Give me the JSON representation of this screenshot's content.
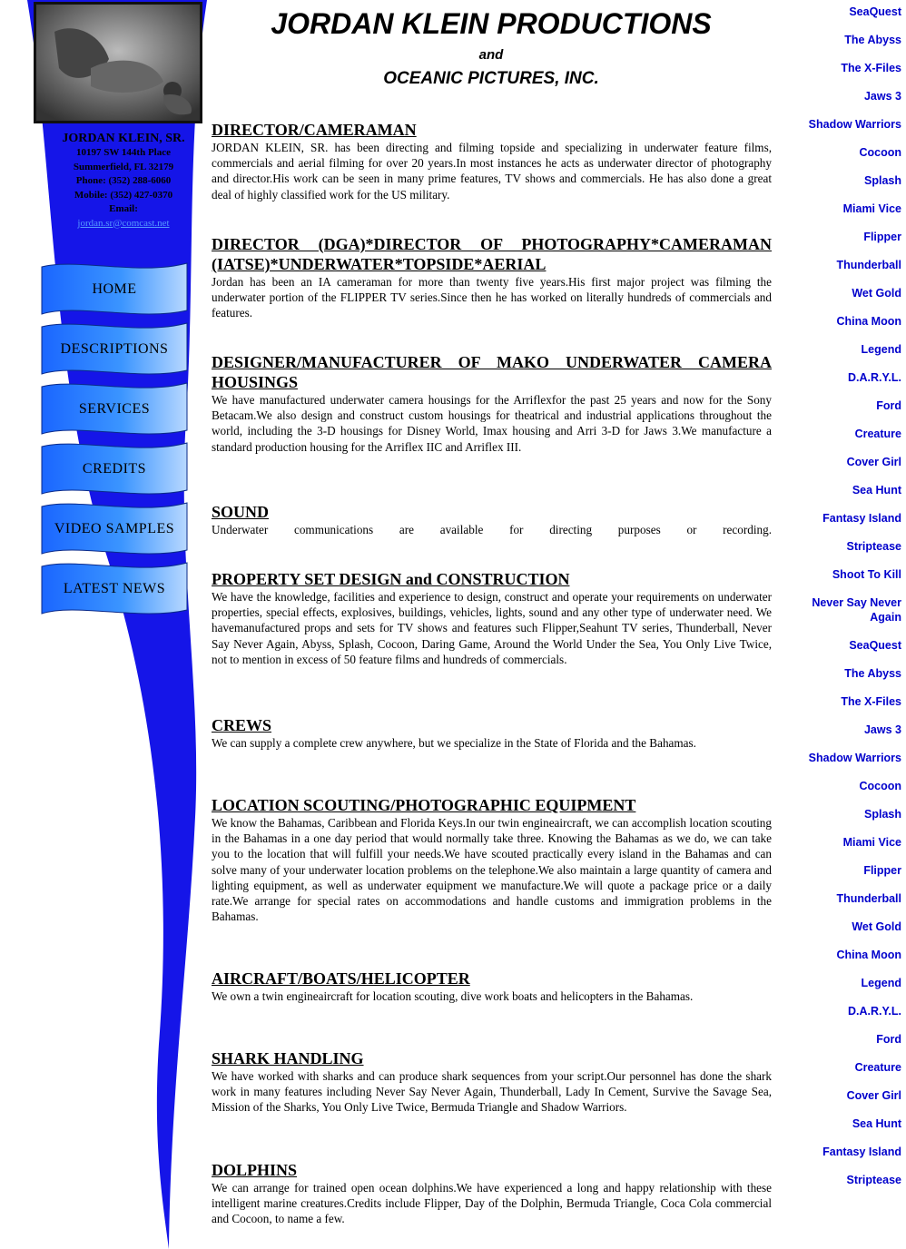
{
  "header": {
    "title": "JORDAN KLEIN PRODUCTIONS",
    "and": "and",
    "subtitle": "OCEANIC PICTURES, INC."
  },
  "contact": {
    "name": "JORDAN KLEIN, SR.",
    "address": "10197 SW 144th Place",
    "city": "Summerfield, FL  32179",
    "phone": "Phone:  (352) 288-6060",
    "mobile": "Mobile: (352) 427-0370",
    "email_label": "Email:",
    "email": "jordan.sr@comcast.net"
  },
  "nav": [
    {
      "label": "HOME"
    },
    {
      "label": "DESCRIPTIONS"
    },
    {
      "label": "SERVICES"
    },
    {
      "label": "CREDITS"
    },
    {
      "label": "VIDEO SAMPLES"
    },
    {
      "label": "LATEST NEWS"
    }
  ],
  "sections": [
    {
      "title": "DIRECTOR/CAMERAMAN",
      "body": "JORDAN KLEIN, SR. has been directing and filming topside and specializing in underwater feature films, commercials and aerial filming for over 20 years.In most instances he acts as underwater director of photography and director.His work can be seen in many prime features, TV shows and commercials. He has also done a great deal of highly classified work for the US military."
    },
    {
      "title": "DIRECTOR (DGA)*DIRECTOR OF PHOTOGRAPHY*CAMERAMAN (IATSE)*UNDERWATER*TOPSIDE*AERIAL",
      "body": "Jordan has been an IA cameraman for more than twenty five years.His first major project was filming the underwater portion of the FLIPPER TV series.Since then he has worked on literally hundreds of commercials and features."
    },
    {
      "title": "DESIGNER/MANUFACTURER OF MAKO UNDERWATER CAMERA HOUSINGS",
      "body": "We have manufactured underwater camera housings for the Arriflexfor the past 25 years and now for the Sony Betacam.We also design and construct custom housings for theatrical and industrial applications throughout the world, including the 3-D housings for Disney World, Imax housing and Arri 3-D for Jaws 3.We manufacture a standard production housing for the Arriflex IIC and Arriflex III."
    },
    {
      "title": "SOUND",
      "body": "Underwater communications are available for directing purposes or recording."
    },
    {
      "title": "PROPERTY SET DESIGN and CONSTRUCTION",
      "body": "We have the knowledge, facilities and experience to design, construct and operate your requirements on underwater properties, special effects, explosives, buildings, vehicles, lights, sound and any other type of underwater need. We havemanufactured props and sets for TV shows and features such Flipper,Seahunt TV series, Thunderball, Never Say Never Again, Abyss, Splash, Cocoon, Daring Game, Around the World Under the Sea, You Only Live Twice, not to mention in excess of 50 feature films and hundreds of commercials."
    },
    {
      "title": "CREWS",
      "body": "We can supply a complete crew anywhere, but we specialize in the State of Florida and the Bahamas."
    },
    {
      "title": "LOCATION SCOUTING/PHOTOGRAPHIC EQUIPMENT",
      "body": "We know the Bahamas, Caribbean and Florida Keys.In our twin engineaircraft, we can accomplish location scouting in the Bahamas in a one day period that would normally take three. Knowing the Bahamas as we do, we can take you to the location that will fulfill your needs.We have scouted practically every island in the Bahamas and can solve many of your underwater location problems on the telephone.We also maintain a large quantity of camera and lighting equipment, as well as underwater equipment we manufacture.We will quote a package price or a daily rate.We arrange for special rates on accommodations and handle customs and immigration problems in the Bahamas."
    },
    {
      "title": "AIRCRAFT/BOATS/HELICOPTER",
      "body": "We own a twin engineaircraft for location scouting, dive work boats and helicopters in the Bahamas."
    },
    {
      "title": "SHARK HANDLING",
      "body": "We have worked with sharks and can produce shark sequences from your script.Our personnel has done the shark work in many features including Never Say Never Again, Thunderball, Lady In Cement, Survive the Savage Sea, Mission of the Sharks, You Only Live Twice, Bermuda Triangle and Shadow Warriors."
    },
    {
      "title": "DOLPHINS",
      "body": "We can arrange for trained open ocean dolphins.We have experienced a long and happy relationship with these intelligent marine creatures.Credits include Flipper, Day of the Dolphin, Bermuda Triangle, Coca Cola commercial and Cocoon, to name a few."
    }
  ],
  "credits_links": [
    "SeaQuest",
    "The Abyss",
    "The X-Files",
    "Jaws 3",
    "Shadow Warriors",
    "Cocoon",
    "Splash",
    "Miami Vice",
    "Flipper",
    "Thunderball",
    "Wet Gold",
    "China Moon",
    "Legend",
    "D.A.R.Y.L.",
    "Ford",
    "Creature",
    "Cover Girl",
    "Sea Hunt",
    "Fantasy Island",
    "Striptease",
    "Shoot To Kill",
    "Never Say Never Again",
    "SeaQuest",
    "The Abyss",
    "The X-Files",
    "Jaws 3",
    "Shadow Warriors",
    "Cocoon",
    "Splash",
    "Miami Vice",
    "Flipper",
    "Thunderball",
    "Wet Gold",
    "China Moon",
    "Legend",
    "D.A.R.Y.L.",
    "Ford",
    "Creature",
    "Cover Girl",
    "Sea Hunt",
    "Fantasy Island",
    "Striptease"
  ],
  "colors": {
    "wave_blue": "#1515e8",
    "link_blue": "#0000cc",
    "nav_button_blue": "#2e8cff"
  }
}
